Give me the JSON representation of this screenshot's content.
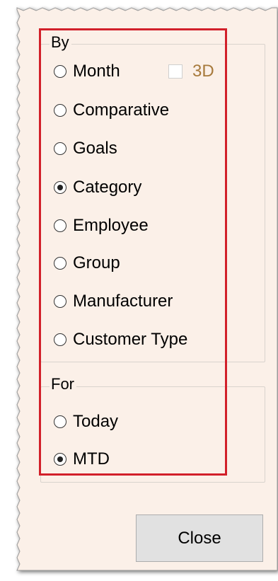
{
  "by_group": {
    "legend": "By",
    "options": [
      {
        "label": "Month",
        "selected": false
      },
      {
        "label": "Comparative",
        "selected": false
      },
      {
        "label": "Goals",
        "selected": false
      },
      {
        "label": "Category",
        "selected": true
      },
      {
        "label": "Employee",
        "selected": false
      },
      {
        "label": "Group",
        "selected": false
      },
      {
        "label": "Manufacturer",
        "selected": false
      },
      {
        "label": "Customer Type",
        "selected": false
      }
    ],
    "three_d_checkbox": {
      "label": "3D",
      "checked": false,
      "enabled": false
    }
  },
  "for_group": {
    "legend": "For",
    "options": [
      {
        "label": "Today",
        "selected": false
      },
      {
        "label": "MTD",
        "selected": true
      }
    ]
  },
  "close_button": {
    "label": "Close"
  },
  "colors": {
    "panel_background": "#fbf0e8",
    "highlight_border": "#d2202a",
    "disabled_text": "#a77a3c",
    "button_face": "#e1e1e1"
  }
}
